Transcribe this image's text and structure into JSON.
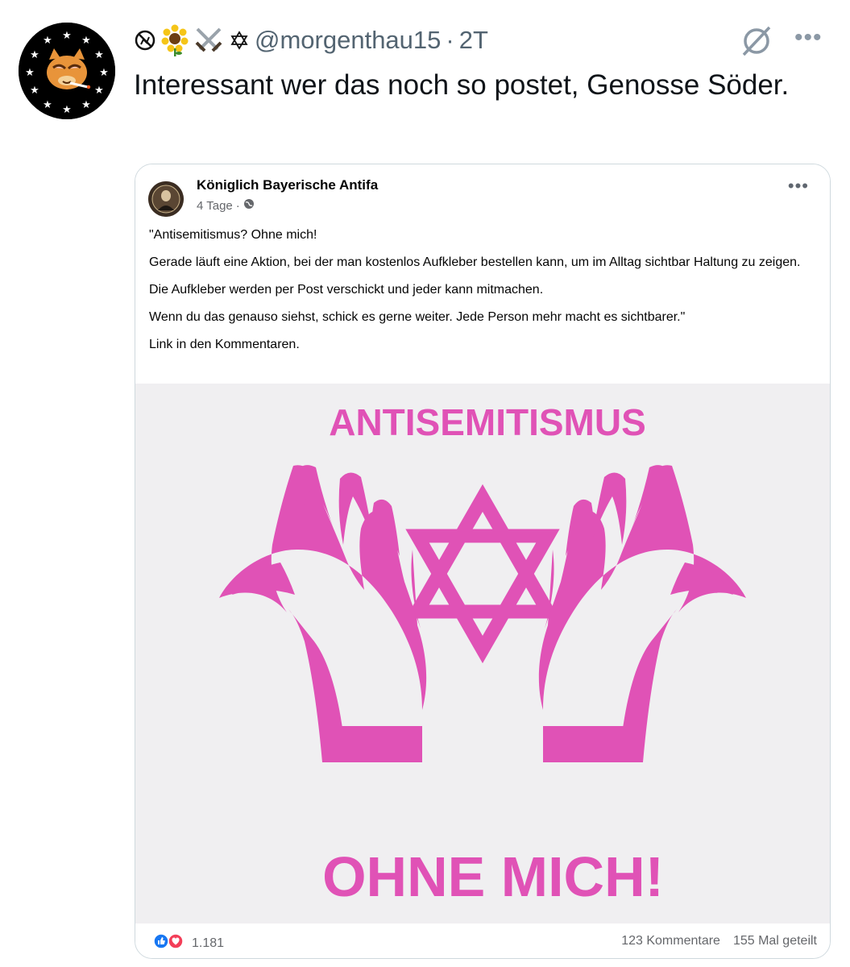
{
  "tweet": {
    "badge_icons": [
      "no-symbol-icon",
      "sunflower-icon",
      "crossed-swords-icon",
      "star-of-david-icon"
    ],
    "handle": "@morgenthau15",
    "separator": "·",
    "time": "2T",
    "text": "Interessant wer das noch so postet, Genosse Söder."
  },
  "embedded_post": {
    "page_name": "Königlich Bayerische Antifa",
    "age": "4 Tage",
    "meta_separator": "·",
    "paragraphs": [
      "\"Antisemitismus? Ohne mich!",
      "Gerade läuft eine Aktion, bei der man kostenlos Aufkleber bestellen kann, um im Alltag sichtbar Haltung zu zeigen.",
      "Die Aufkleber werden per Post verschickt und jeder kann mitmachen.",
      "Wenn du das genauso siehst, schick es gerne weiter. Jede Person mehr macht es sichtbarer.\"",
      "Link in den Kommentaren."
    ],
    "image": {
      "headline": "ANTISEMITISMUS",
      "tagline": "OHNE MICH!",
      "accent_color": "#e052b6"
    },
    "reaction_count": "1.181",
    "comments": "123 Kommentare",
    "shares": "155 Mal geteilt"
  },
  "colors": {
    "muted_text": "#536471",
    "card_border": "#cfd9de",
    "fb_like_blue": "#1877f2",
    "fb_love_red": "#f33e58"
  }
}
